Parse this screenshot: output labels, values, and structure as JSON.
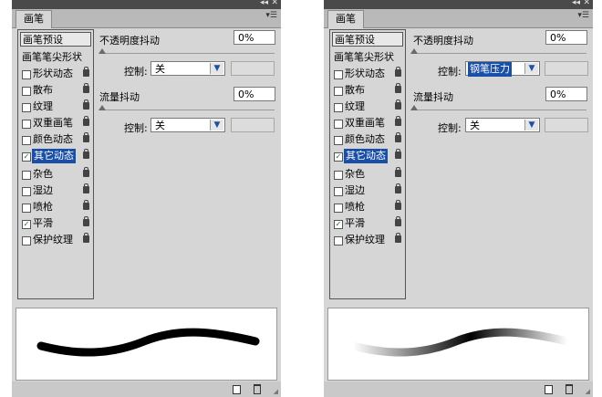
{
  "panels": [
    {
      "tab": "画笔",
      "preset_button": "画笔预设",
      "tip_shape": "画笔笔尖形状",
      "items": [
        {
          "label": "形状动态",
          "checked": false,
          "selected": false
        },
        {
          "label": "散布",
          "checked": false,
          "selected": false
        },
        {
          "label": "纹理",
          "checked": false,
          "selected": false
        },
        {
          "label": "双重画笔",
          "checked": false,
          "selected": false
        },
        {
          "label": "颜色动态",
          "checked": false,
          "selected": false
        },
        {
          "label": "其它动态",
          "checked": true,
          "selected": true
        },
        {
          "label": "杂色",
          "checked": false,
          "selected": false
        },
        {
          "label": "湿边",
          "checked": false,
          "selected": false
        },
        {
          "label": "喷枪",
          "checked": false,
          "selected": false
        },
        {
          "label": "平滑",
          "checked": true,
          "selected": false
        },
        {
          "label": "保护纹理",
          "checked": false,
          "selected": false
        }
      ],
      "opacity_jitter": {
        "label": "不透明度抖动",
        "value": "0%",
        "control_label": "控制:",
        "control_value": "关"
      },
      "flow_jitter": {
        "label": "流量抖动",
        "value": "0%",
        "control_label": "控制:",
        "control_value": "关"
      }
    },
    {
      "tab": "画笔",
      "preset_button": "画笔预设",
      "tip_shape": "画笔笔尖形状",
      "items": [
        {
          "label": "形状动态",
          "checked": false,
          "selected": false
        },
        {
          "label": "散布",
          "checked": false,
          "selected": false
        },
        {
          "label": "纹理",
          "checked": false,
          "selected": false
        },
        {
          "label": "双重画笔",
          "checked": false,
          "selected": false
        },
        {
          "label": "颜色动态",
          "checked": false,
          "selected": false
        },
        {
          "label": "其它动态",
          "checked": true,
          "selected": true
        },
        {
          "label": "杂色",
          "checked": false,
          "selected": false
        },
        {
          "label": "湿边",
          "checked": false,
          "selected": false
        },
        {
          "label": "喷枪",
          "checked": false,
          "selected": false
        },
        {
          "label": "平滑",
          "checked": true,
          "selected": false
        },
        {
          "label": "保护纹理",
          "checked": false,
          "selected": false
        }
      ],
      "opacity_jitter": {
        "label": "不透明度抖动",
        "value": "0%",
        "control_label": "控制:",
        "control_value": "钢笔压力"
      },
      "flow_jitter": {
        "label": "流量抖动",
        "value": "0%",
        "control_label": "控制:",
        "control_value": "关"
      }
    }
  ],
  "icons": {
    "collapse": "double-chevron-icon",
    "close": "close-icon",
    "menu": "panel-menu-icon",
    "lock": "lock-icon",
    "new": "new-brush-icon",
    "trash": "trash-icon"
  },
  "colors": {
    "selection": "#1a4fa8",
    "panel_bg": "#d6d6d6",
    "stroke": "#000000"
  }
}
